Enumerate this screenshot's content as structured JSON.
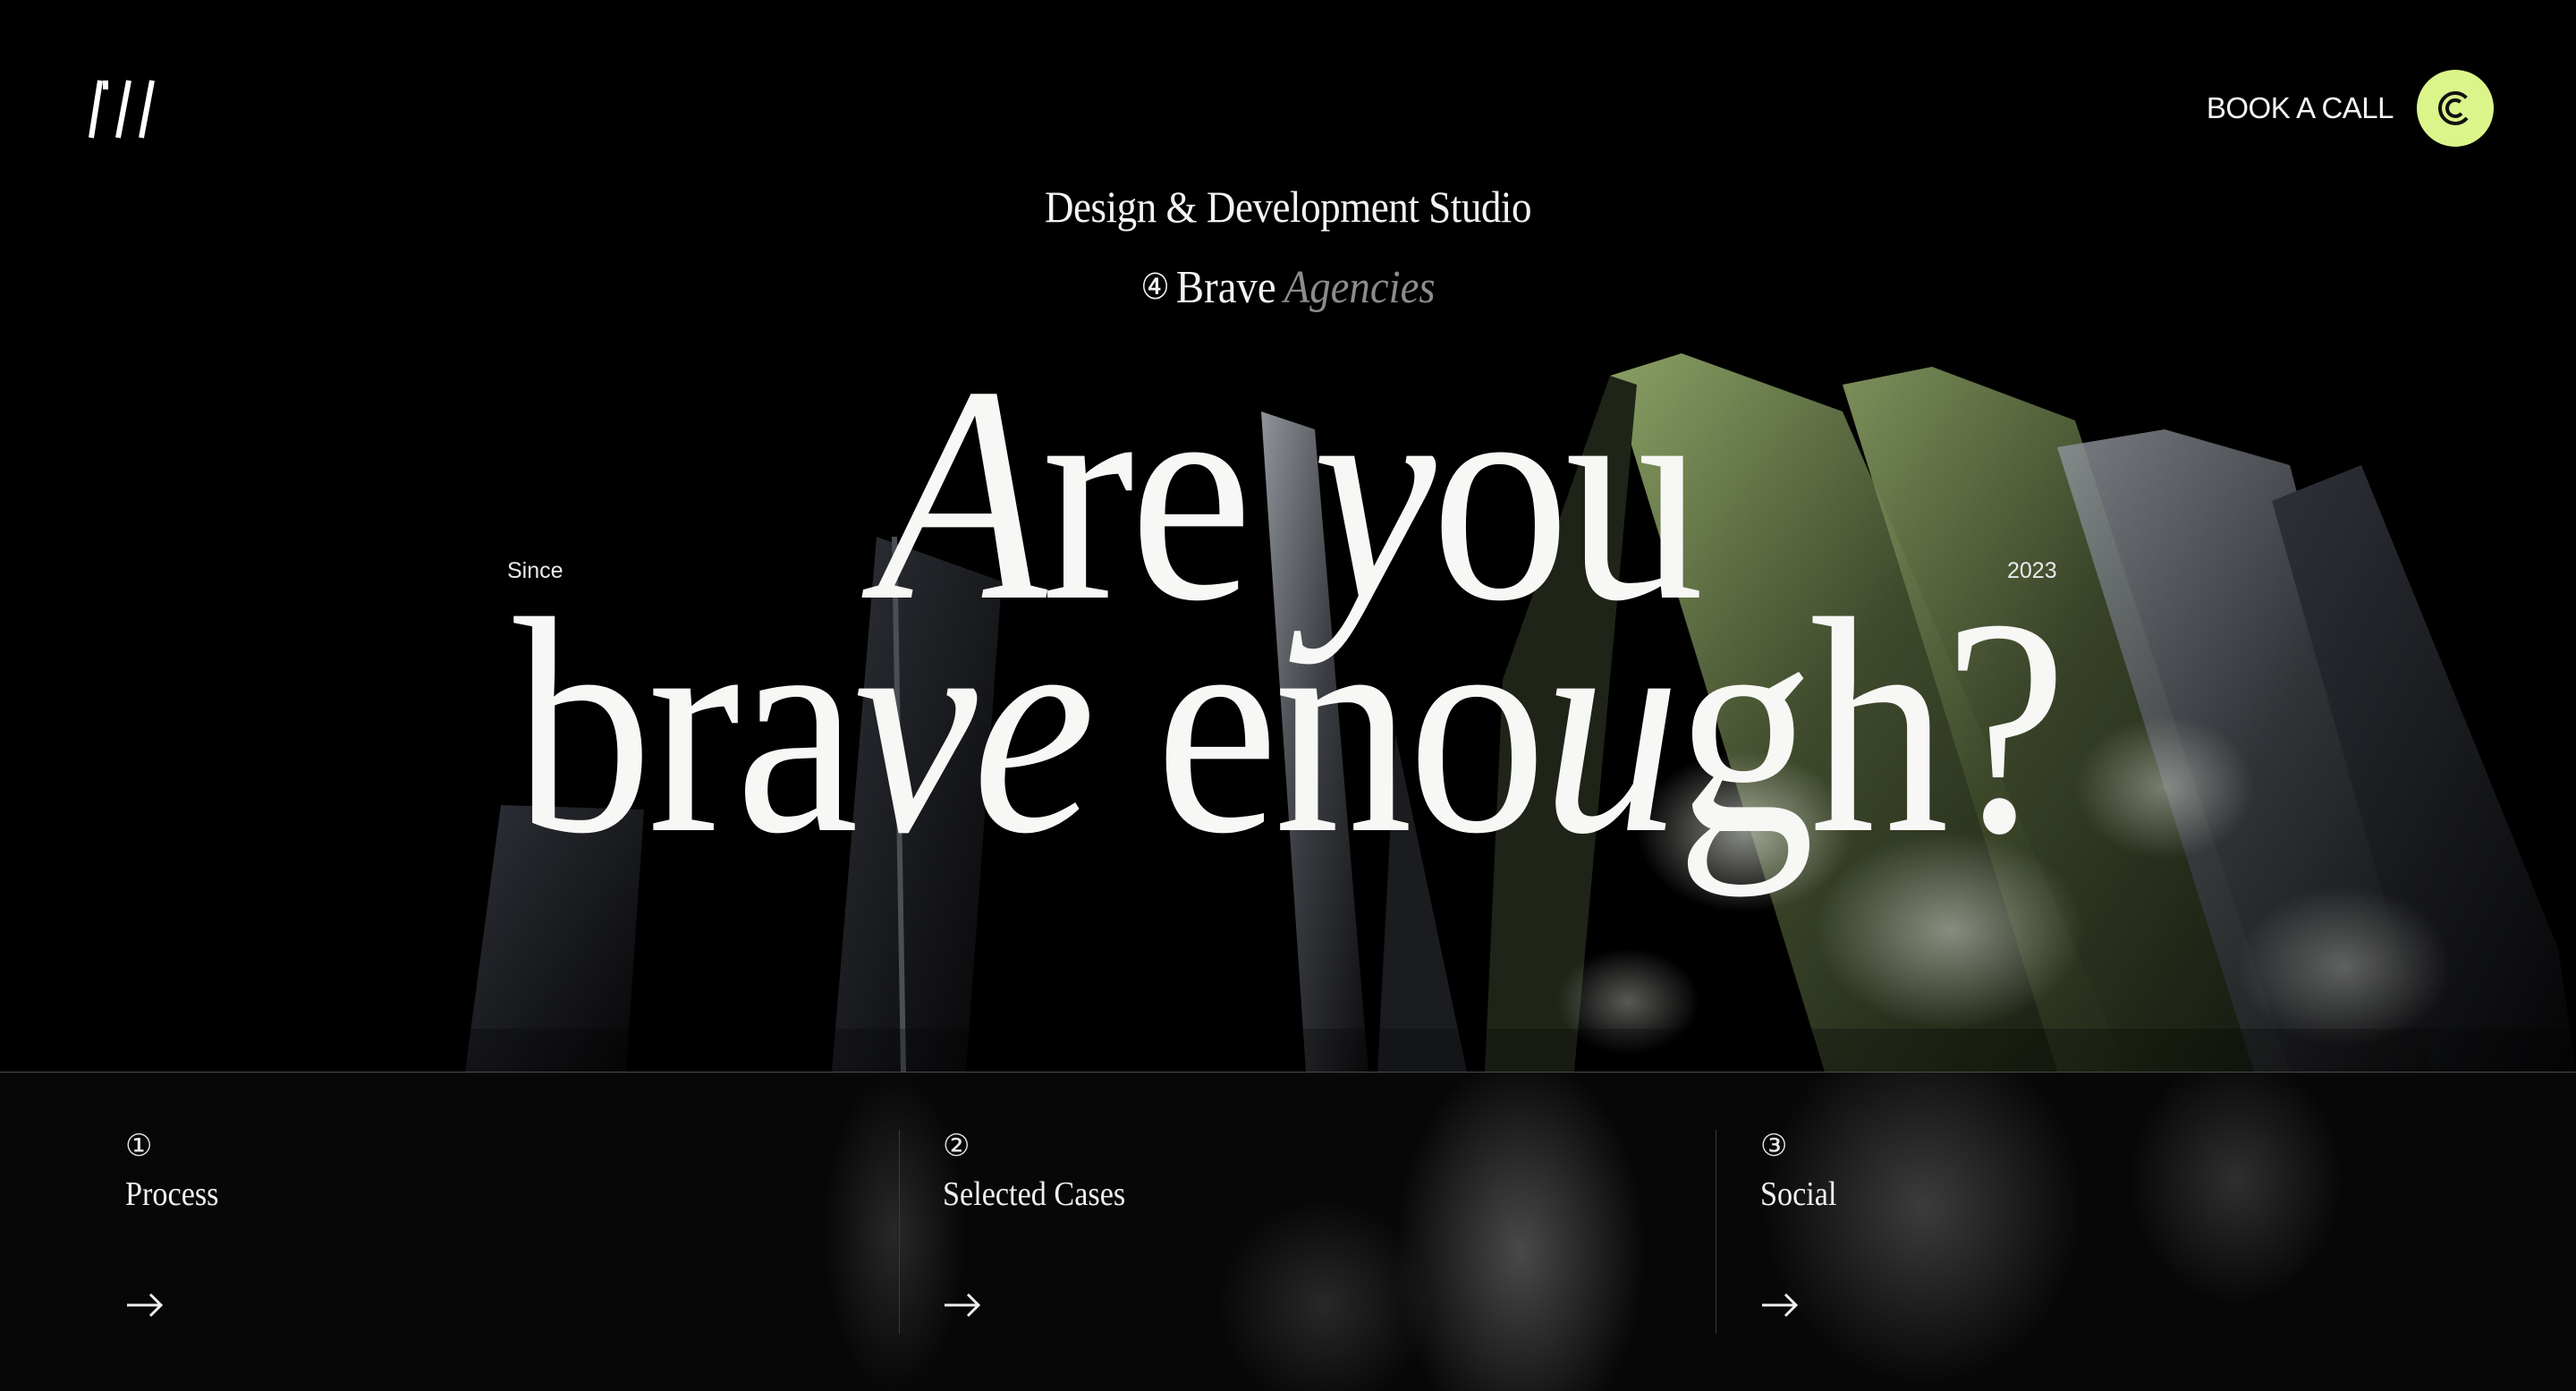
{
  "header": {
    "logo": "studio-logo",
    "cta_label": "BOOK A CALL",
    "cta_icon": "brand-c-icon",
    "accent": "#dcf58a"
  },
  "hero": {
    "subtitle": "Design & Development Studio",
    "badge_number": "④",
    "badge_word": "Brave",
    "badge_muted": "Agencies",
    "since_label": "Since",
    "year_label": "2023",
    "line1": {
      "a": "A",
      "b": "re ",
      "c": "y",
      "d": "ou"
    },
    "line2": {
      "a": "bra",
      "b": "ve",
      "c": " eno",
      "d": "u",
      "e": "gh?"
    }
  },
  "cards": [
    {
      "number": "①",
      "title": "Process",
      "arrow": "arrow-right-icon"
    },
    {
      "number": "②",
      "title": "Selected Cases",
      "arrow": "arrow-right-icon"
    },
    {
      "number": "③",
      "title": "Social",
      "arrow": "arrow-right-icon"
    }
  ],
  "colors": {
    "background": "#000000",
    "text": "#f2f2f2",
    "muted": "#8c8c8c",
    "accent": "#dcf58a"
  }
}
